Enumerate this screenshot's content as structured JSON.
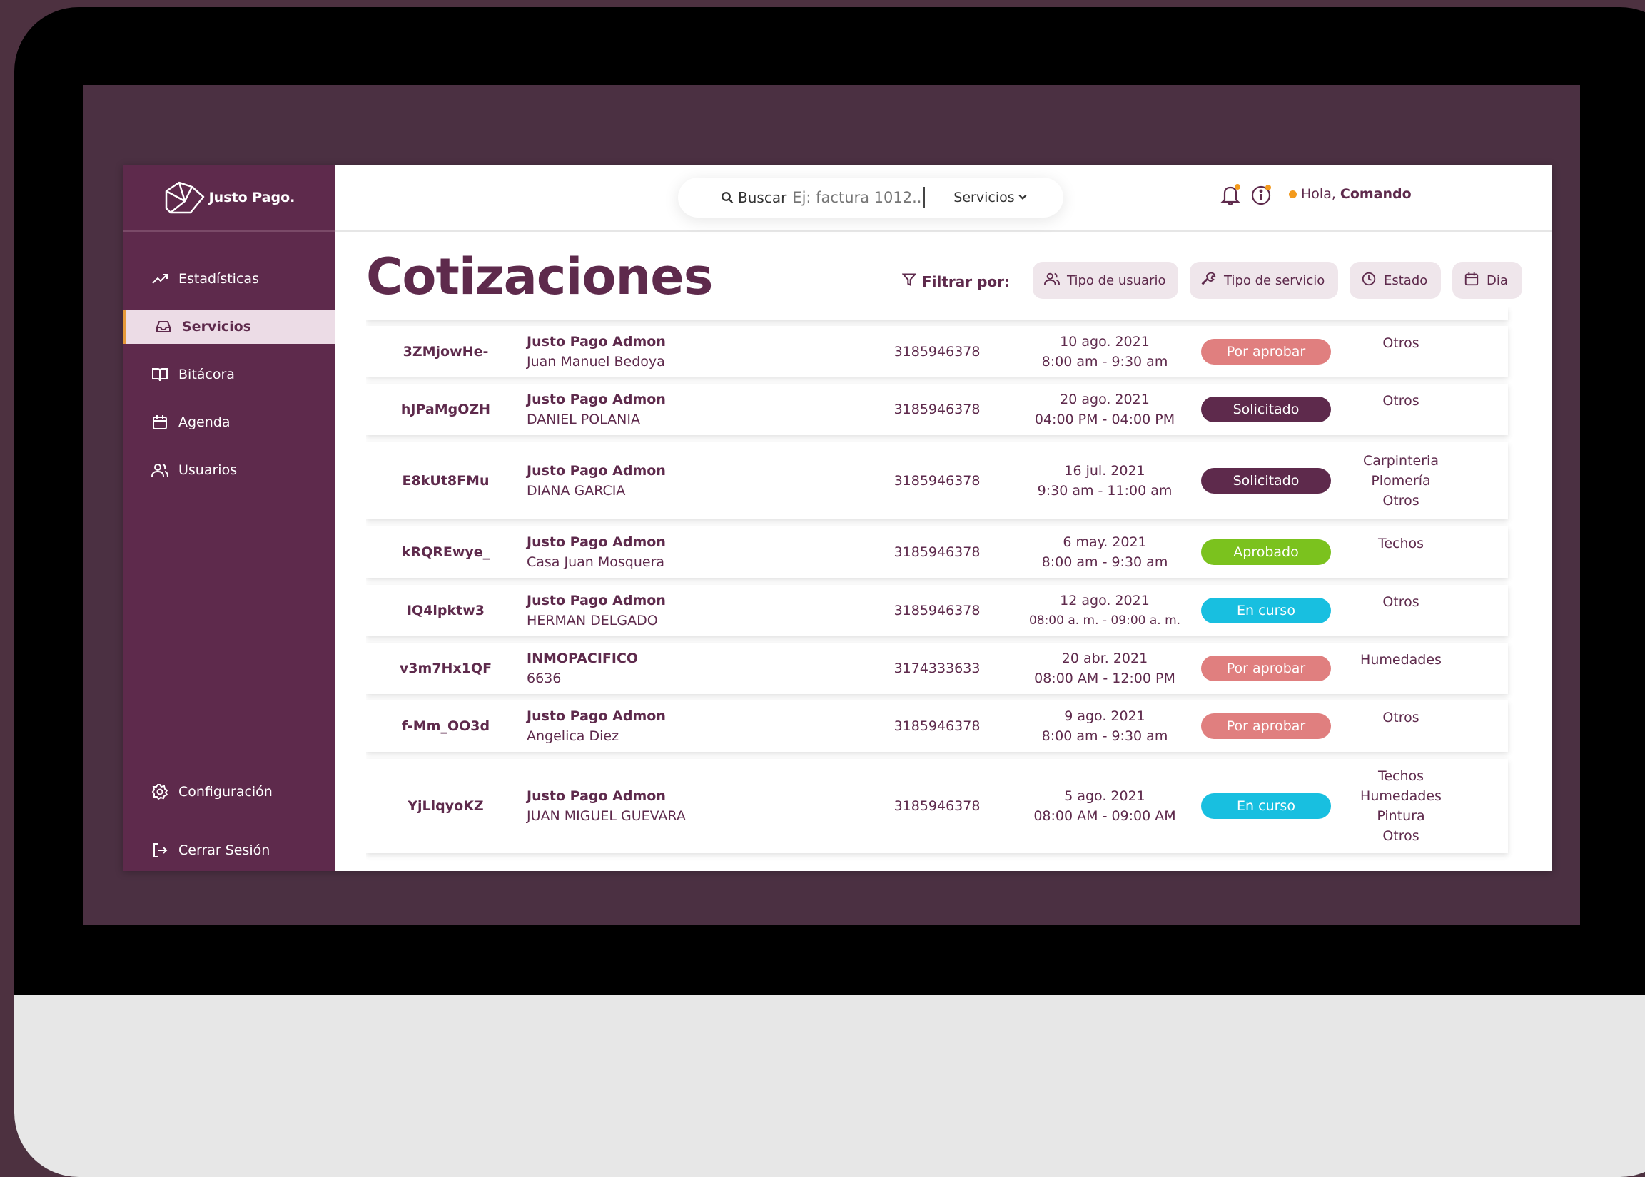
{
  "brand": {
    "name": "Justo Pago."
  },
  "sidebar": {
    "items": [
      {
        "label": "Estadísticas",
        "icon": "trending-up-icon",
        "active": false
      },
      {
        "label": "Servicios",
        "icon": "inbox-icon",
        "active": true
      },
      {
        "label": "Bitácora",
        "icon": "book-icon",
        "active": false
      },
      {
        "label": "Agenda",
        "icon": "calendar-icon",
        "active": false
      },
      {
        "label": "Usuarios",
        "icon": "users-icon",
        "active": false
      }
    ],
    "bottom": [
      {
        "label": "Configuración",
        "icon": "gear-icon"
      },
      {
        "label": "Cerrar Sesión",
        "icon": "logout-icon"
      }
    ]
  },
  "topbar": {
    "search_label": "Buscar",
    "search_placeholder": "Ej: factura 1012...",
    "services_select": "Servicios",
    "greeting_prefix": "Hola,",
    "greeting_name": "Comando"
  },
  "page": {
    "title": "Cotizaciones",
    "filter_label": "Filtrar por:",
    "filters": [
      "Tipo de usuario",
      "Tipo de servicio",
      "Estado",
      "Dia"
    ]
  },
  "colors": {
    "brand": "#5e2a4c",
    "accent": "#f39a1c",
    "status_por_aprobar": "#e07f7f",
    "status_solicitado": "#5e2a4c",
    "status_aprobado": "#7bc21e",
    "status_en_curso": "#18bfe0"
  },
  "rows": [
    {
      "id": "3ZMjowHe-",
      "company": "Justo Pago Admon",
      "name": "Juan Manuel Bedoya",
      "phone": "3185946378",
      "date": "10 ago. 2021",
      "time": "8:00 am - 9:30 am",
      "status": "Por aprobar",
      "categories": [
        "Otros"
      ]
    },
    {
      "id": "hJPaMgOZH",
      "company": "Justo Pago Admon",
      "name": "DANIEL POLANIA",
      "phone": "3185946378",
      "date": "20 ago. 2021",
      "time": "04:00 PM - 04:00 PM",
      "status": "Solicitado",
      "categories": [
        "Otros"
      ]
    },
    {
      "id": "E8kUt8FMu",
      "company": "Justo Pago Admon",
      "name": "DIANA GARCIA",
      "phone": "3185946378",
      "date": "16 jul. 2021",
      "time": "9:30 am - 11:00 am",
      "status": "Solicitado",
      "categories": [
        "Carpinteria",
        "Plomería",
        "Otros"
      ]
    },
    {
      "id": "kRQREwye_",
      "company": "Justo Pago Admon",
      "name": "Casa Juan Mosquera",
      "phone": "3185946378",
      "date": "6 may. 2021",
      "time": "8:00 am - 9:30 am",
      "status": "Aprobado",
      "categories": [
        "Techos"
      ]
    },
    {
      "id": "IQ4lpktw3",
      "company": "Justo Pago Admon",
      "name": "HERMAN DELGADO",
      "phone": "3185946378",
      "date": "12 ago. 2021",
      "time": "08:00 a. m. - 09:00 a. m.",
      "status": "En curso",
      "categories": [
        "Otros"
      ]
    },
    {
      "id": "v3m7Hx1QF",
      "company": "INMOPACIFICO",
      "name": "6636",
      "phone": "3174333633",
      "date": "20 abr. 2021",
      "time": "08:00 AM - 12:00 PM",
      "status": "Por aprobar",
      "categories": [
        "Humedades"
      ]
    },
    {
      "id": "f-Mm_OO3d",
      "company": "Justo Pago Admon",
      "name": "Angelica Diez",
      "phone": "3185946378",
      "date": "9 ago. 2021",
      "time": "8:00 am - 9:30 am",
      "status": "Por aprobar",
      "categories": [
        "Otros"
      ]
    },
    {
      "id": "YjLlqyoKZ",
      "company": "Justo Pago Admon",
      "name": "JUAN MIGUEL GUEVARA",
      "phone": "3185946378",
      "date": "5 ago. 2021",
      "time": "08:00 AM - 09:00 AM",
      "status": "En curso",
      "categories": [
        "Techos",
        "Humedades",
        "Pintura",
        "Otros"
      ]
    }
  ]
}
